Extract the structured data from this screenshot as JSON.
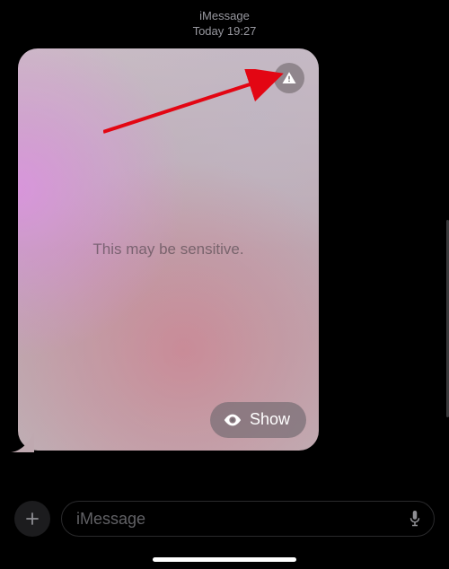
{
  "header": {
    "service": "iMessage",
    "timestamp": "Today 19:27"
  },
  "message": {
    "sensitive_label": "This may be sensitive.",
    "show_label": "Show"
  },
  "composer": {
    "placeholder": "iMessage"
  }
}
